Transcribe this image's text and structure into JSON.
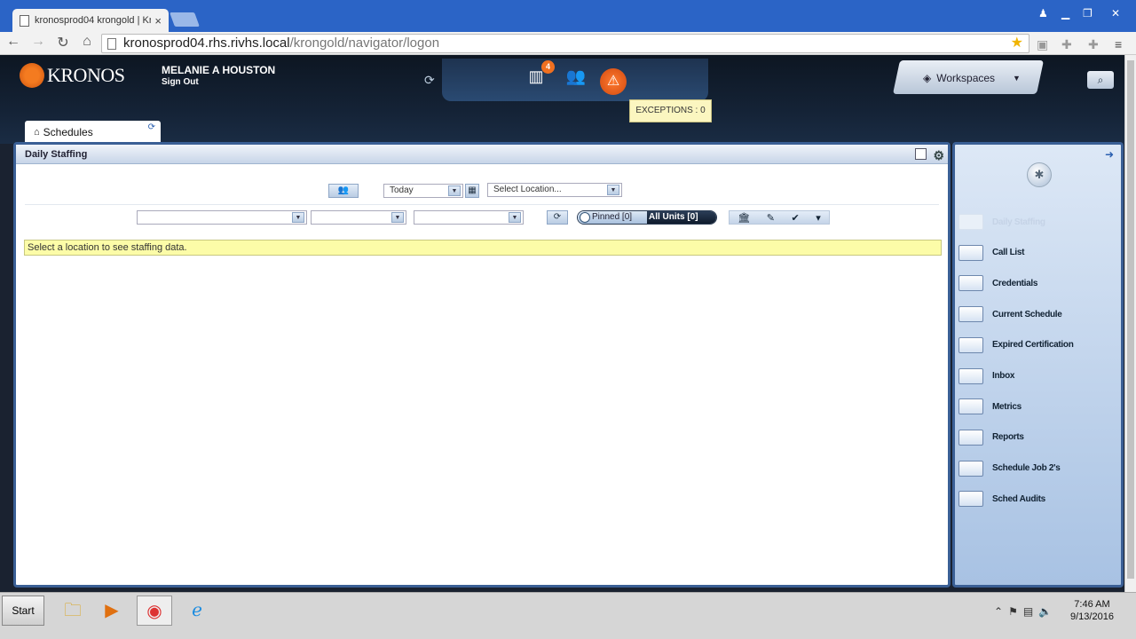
{
  "browser": {
    "tab_title": "kronosprod04 krongold | Kr",
    "tab_close": "×",
    "url_host": "kronosprod04.rhs.rivhs.local",
    "url_path": "/krongold/navigator/logon"
  },
  "header": {
    "logo": "KRONOS",
    "user_name": "MELANIE A HOUSTON",
    "signout": "Sign Out",
    "badge_count": "4",
    "tooltip": "EXCEPTIONS : 0",
    "workspaces_label": "Workspaces"
  },
  "tab": {
    "label": "Schedules"
  },
  "panel": {
    "title": "Daily Staffing",
    "date_value": "Today",
    "location_placeholder": "Select Location...",
    "pinned_label": "Pinned [0]",
    "allunits_label": "All Units [0]",
    "notice": "Select a location to see staffing data."
  },
  "workspace_items": [
    {
      "label": "Daily Staffing",
      "disabled": true
    },
    {
      "label": "Call List"
    },
    {
      "label": "Credentials"
    },
    {
      "label": "Current Schedule"
    },
    {
      "label": "Expired Certification"
    },
    {
      "label": "Inbox"
    },
    {
      "label": "Metrics"
    },
    {
      "label": "Reports"
    },
    {
      "label": "Schedule Job 2's"
    },
    {
      "label": "Sched Audits"
    }
  ],
  "taskbar": {
    "start_label": "Start",
    "time": "7:46 AM",
    "date": "9/13/2016"
  },
  "colors": {
    "chrome_blue": "#2b64c6",
    "panel_border": "#3a5f95",
    "kronos_orange": "#f47b20",
    "notice_bg": "#fcfca8"
  }
}
